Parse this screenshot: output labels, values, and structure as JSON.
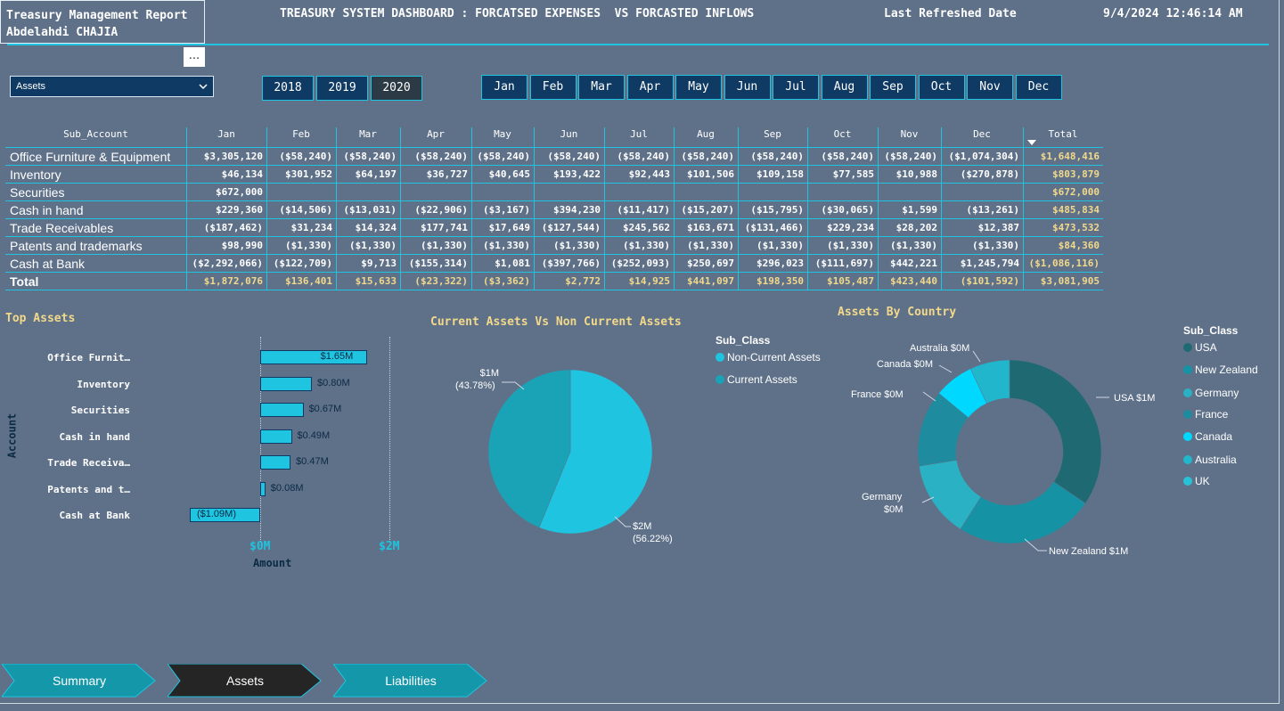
{
  "header": {
    "report_title": "Treasury Management Report",
    "author": "Abdelahdi CHAJIA",
    "headline": "TREASURY SYSTEM DASHBOARD : FORCATSED EXPENSES  VS FORCASTED INFLOWS",
    "refresh_label": "Last Refreshed Date",
    "refresh_value": "9/4/2024 12:46:14 AM",
    "more_icon": "..."
  },
  "dropdown": {
    "value": "Assets"
  },
  "years": [
    {
      "label": "2018",
      "selected": false
    },
    {
      "label": "2019",
      "selected": false
    },
    {
      "label": "2020",
      "selected": true
    }
  ],
  "months": [
    "Jan",
    "Feb",
    "Mar",
    "Apr",
    "May",
    "Jun",
    "Jul",
    "Aug",
    "Sep",
    "Oct",
    "Nov",
    "Dec"
  ],
  "table": {
    "headers": [
      "Sub_Account",
      "Jan",
      "Feb",
      "Mar",
      "Apr",
      "May",
      "Jun",
      "Jul",
      "Aug",
      "Sep",
      "Oct",
      "Nov",
      "Dec",
      "Total"
    ],
    "rows": [
      [
        "Office Furniture & Equipment",
        "$3,305,120",
        "($58,240)",
        "($58,240)",
        "($58,240)",
        "($58,240)",
        "($58,240)",
        "($58,240)",
        "($58,240)",
        "($58,240)",
        "($58,240)",
        "($58,240)",
        "($1,074,304)",
        "$1,648,416"
      ],
      [
        "Inventory",
        "$46,134",
        "$301,952",
        "$64,197",
        "$36,727",
        "$40,645",
        "$193,422",
        "$92,443",
        "$101,506",
        "$109,158",
        "$77,585",
        "$10,988",
        "($270,878)",
        "$803,879"
      ],
      [
        "Securities",
        "$672,000",
        "",
        "",
        "",
        "",
        "",
        "",
        "",
        "",
        "",
        "",
        "",
        "$672,000"
      ],
      [
        "Cash in hand",
        "$229,360",
        "($14,506)",
        "($13,031)",
        "($22,906)",
        "($3,167)",
        "$394,230",
        "($11,417)",
        "($15,207)",
        "($15,795)",
        "($30,065)",
        "$1,599",
        "($13,261)",
        "$485,834"
      ],
      [
        "Trade Receivables",
        "($187,462)",
        "$31,234",
        "$14,324",
        "$177,741",
        "$17,649",
        "($127,544)",
        "$245,562",
        "$163,671",
        "($131,466)",
        "$229,234",
        "$28,202",
        "$12,387",
        "$473,532"
      ],
      [
        "Patents and trademarks",
        "$98,990",
        "($1,330)",
        "($1,330)",
        "($1,330)",
        "($1,330)",
        "($1,330)",
        "($1,330)",
        "($1,330)",
        "($1,330)",
        "($1,330)",
        "($1,330)",
        "($1,330)",
        "$84,360"
      ],
      [
        "Cash at Bank",
        "($2,292,066)",
        "($122,709)",
        "$9,713",
        "($155,314)",
        "$1,081",
        "($397,766)",
        "($252,093)",
        "$250,697",
        "$296,023",
        "($111,697)",
        "$442,221",
        "$1,245,794",
        "($1,086,116)"
      ]
    ],
    "total_row": [
      "Total",
      "$1,872,076",
      "$136,401",
      "$15,633",
      "($23,322)",
      "($3,362)",
      "$2,772",
      "$14,925",
      "$441,097",
      "$198,350",
      "$105,487",
      "$423,440",
      "($101,592)",
      "$3,081,905"
    ]
  },
  "top_assets": {
    "title": "Top Assets",
    "y_axis_title": "Account",
    "x_axis_title": "Amount",
    "x_ticks": [
      "$0M",
      "$2M"
    ],
    "chart_data": {
      "type": "bar",
      "categories": [
        "Office Furnit…",
        "Inventory",
        "Securities",
        "Cash in hand",
        "Trade Receiva…",
        "Patents and t…",
        "Cash at Bank"
      ],
      "values": [
        1.65,
        0.8,
        0.67,
        0.49,
        0.47,
        0.08,
        -1.09
      ],
      "value_labels": [
        "$1.65M",
        "$0.80M",
        "$0.67M",
        "$0.49M",
        "$0.47M",
        "$0.08M",
        "($1.09M)"
      ],
      "xlim": [
        -1.09,
        2
      ],
      "color": "#1ec4e0"
    }
  },
  "current_vs_noncurrent": {
    "title": "Current Assets Vs Non Current Assets",
    "legend_title": "Sub_Class",
    "legend": [
      {
        "name": "Non-Current Assets",
        "color": "#1ec4e0"
      },
      {
        "name": "Current Assets",
        "color": "#1aa3b6"
      }
    ],
    "labels": [
      {
        "value": "$1M",
        "pct": "(43.78%)"
      },
      {
        "value": "$2M",
        "pct": "(56.22%)"
      }
    ],
    "chart_data": {
      "type": "pie",
      "slices": [
        {
          "name": "Non-Current Assets",
          "value": 56.22,
          "color": "#1ec4e0"
        },
        {
          "name": "Current Assets",
          "value": 43.78,
          "color": "#1aa3b6"
        }
      ]
    }
  },
  "by_country": {
    "title": "Assets By Country",
    "legend_title": "Sub_Class",
    "legend": [
      {
        "name": "USA",
        "color": "#1f6a72"
      },
      {
        "name": "New Zealand",
        "color": "#1593a4"
      },
      {
        "name": "Germany",
        "color": "#2ab1c4"
      },
      {
        "name": "France",
        "color": "#1e8b9e"
      },
      {
        "name": "Canada",
        "color": "#00d8ff"
      },
      {
        "name": "Australia",
        "color": "#22b6cc"
      },
      {
        "name": "UK",
        "color": "#27c2d8"
      }
    ],
    "labels": [
      "USA $1M",
      "New Zealand $1M",
      "Germany",
      "$0M",
      "France $0M",
      "Canada $0M",
      "Australia $0M"
    ],
    "chart_data": {
      "type": "pie",
      "donut": true,
      "slices": [
        {
          "name": "USA",
          "value": 0.345,
          "color": "#1f6a72"
        },
        {
          "name": "New Zealand",
          "value": 0.245,
          "color": "#1593a4"
        },
        {
          "name": "Germany",
          "value": 0.135,
          "color": "#2ab1c4"
        },
        {
          "name": "France",
          "value": 0.135,
          "color": "#1e8b9e"
        },
        {
          "name": "Canada",
          "value": 0.07,
          "color": "#00d8ff"
        },
        {
          "name": "Australia",
          "value": 0.07,
          "color": "#22b6cc"
        }
      ]
    }
  },
  "nav": [
    {
      "label": "Summary",
      "active": false
    },
    {
      "label": "Assets",
      "active": true
    },
    {
      "label": "Liabilities",
      "active": false
    }
  ]
}
